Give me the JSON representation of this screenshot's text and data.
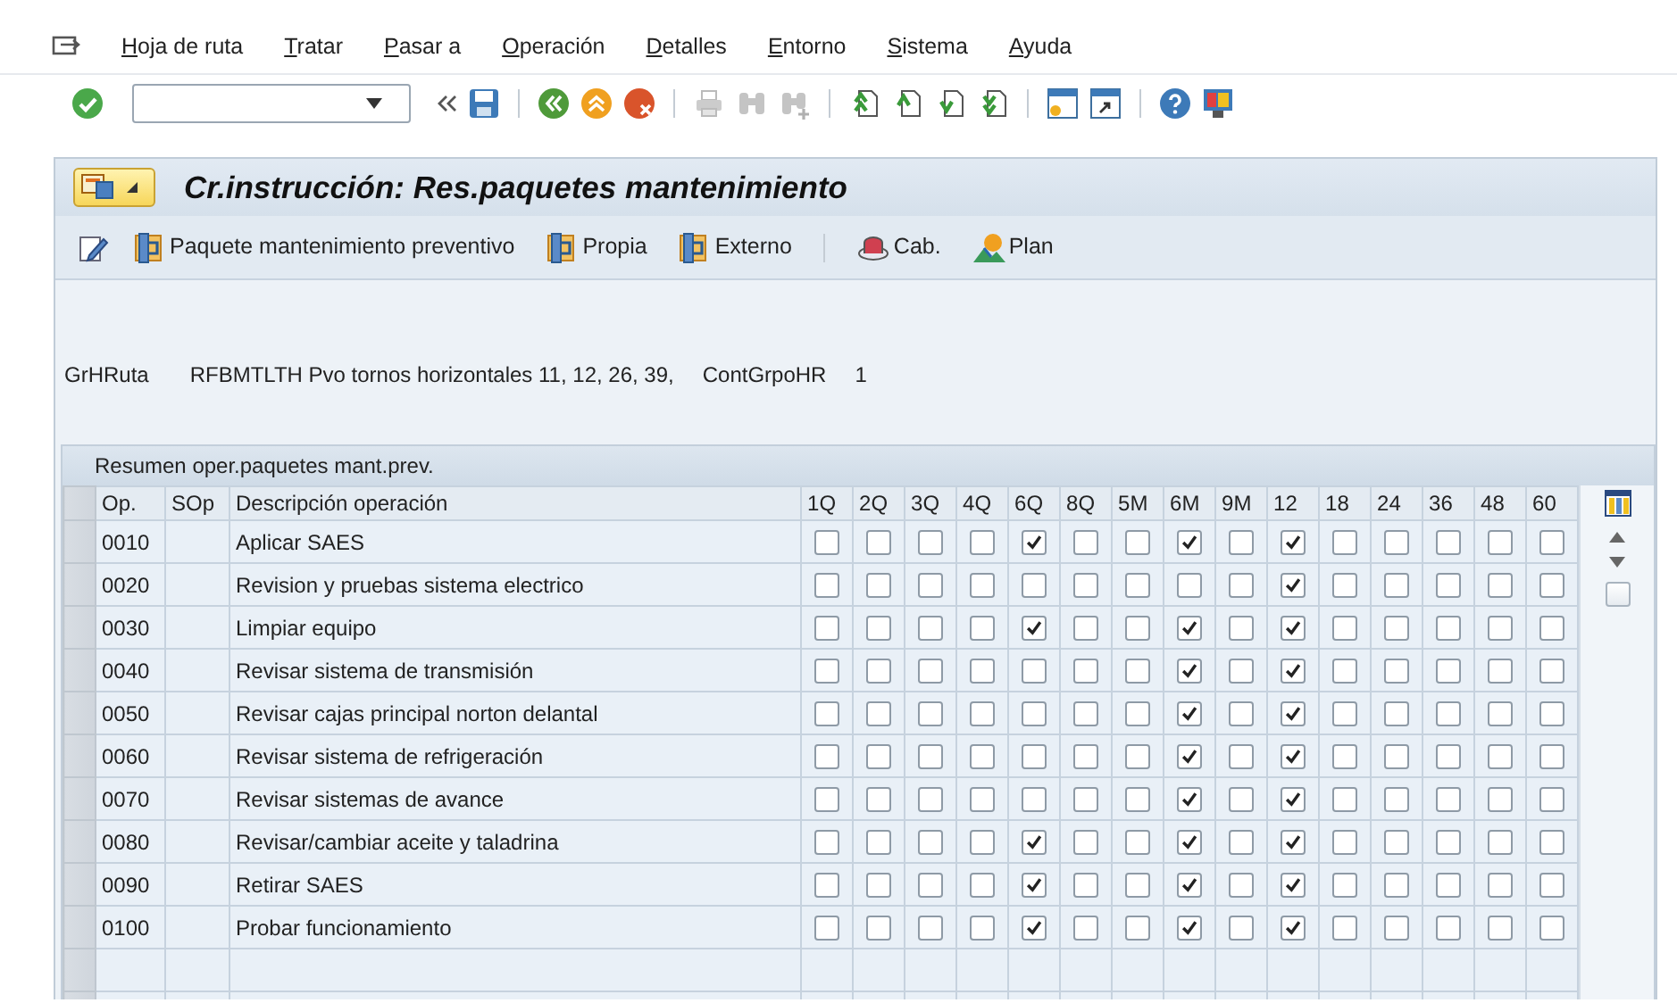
{
  "menu": [
    {
      "label": "Hoja de ruta"
    },
    {
      "label": "Tratar"
    },
    {
      "label": "Pasar a"
    },
    {
      "label": "Operación"
    },
    {
      "label": "Detalles"
    },
    {
      "label": "Entorno"
    },
    {
      "label": "Sistema"
    },
    {
      "label": "Ayuda"
    }
  ],
  "title": "Cr.instrucción: Res.paquetes mantenimiento",
  "app_toolbar": [
    {
      "label": "Paquete mantenimiento preventivo",
      "kind": "package"
    },
    {
      "label": "Propia",
      "kind": "package"
    },
    {
      "label": "Externo",
      "kind": "package"
    },
    {
      "label": "Cab.",
      "kind": "header"
    },
    {
      "label": "Plan",
      "kind": "plan"
    }
  ],
  "header_fields": [
    {
      "label": "GrHRuta",
      "value": "RFBMTLTH Pvo tornos horizontales 11, 12, 26, 39,"
    },
    {
      "label": "ContGrpoHR",
      "value": "1"
    }
  ],
  "table": {
    "title": "Resumen oper.paquetes mant.prev.",
    "columns": [
      "Op.",
      "SOp",
      "Descripción operación",
      "1Q",
      "2Q",
      "3Q",
      "4Q",
      "6Q",
      "8Q",
      "5M",
      "6M",
      "9M",
      "12",
      "18",
      "24",
      "36",
      "48",
      "60"
    ],
    "rows": [
      {
        "op": "0010",
        "description": "Aplicar SAES",
        "checks": [
          false,
          false,
          false,
          false,
          true,
          false,
          false,
          true,
          false,
          true,
          false,
          false,
          false,
          false,
          false
        ]
      },
      {
        "op": "0020",
        "description": "Revision y pruebas sistema electrico",
        "checks": [
          false,
          false,
          false,
          false,
          false,
          false,
          false,
          false,
          false,
          true,
          false,
          false,
          false,
          false,
          false
        ]
      },
      {
        "op": "0030",
        "description": "Limpiar equipo",
        "checks": [
          false,
          false,
          false,
          false,
          true,
          false,
          false,
          true,
          false,
          true,
          false,
          false,
          false,
          false,
          false
        ]
      },
      {
        "op": "0040",
        "description": "Revisar sistema de transmisión",
        "checks": [
          false,
          false,
          false,
          false,
          false,
          false,
          false,
          true,
          false,
          true,
          false,
          false,
          false,
          false,
          false
        ]
      },
      {
        "op": "0050",
        "description": "Revisar cajas principal norton delantal",
        "checks": [
          false,
          false,
          false,
          false,
          false,
          false,
          false,
          true,
          false,
          true,
          false,
          false,
          false,
          false,
          false
        ]
      },
      {
        "op": "0060",
        "description": "Revisar sistema de refrigeración",
        "checks": [
          false,
          false,
          false,
          false,
          false,
          false,
          false,
          true,
          false,
          true,
          false,
          false,
          false,
          false,
          false
        ]
      },
      {
        "op": "0070",
        "description": "Revisar sistemas de avance",
        "checks": [
          false,
          false,
          false,
          false,
          false,
          false,
          false,
          true,
          false,
          true,
          false,
          false,
          false,
          false,
          false
        ]
      },
      {
        "op": "0080",
        "description": "Revisar/cambiar aceite y taladrina",
        "checks": [
          false,
          false,
          false,
          false,
          true,
          false,
          false,
          true,
          false,
          true,
          false,
          false,
          false,
          false,
          false
        ]
      },
      {
        "op": "0090",
        "description": "Retirar SAES",
        "checks": [
          false,
          false,
          false,
          false,
          true,
          false,
          false,
          true,
          false,
          true,
          false,
          false,
          false,
          false,
          false
        ]
      },
      {
        "op": "0100",
        "description": "Probar funcionamiento",
        "checks": [
          false,
          false,
          false,
          false,
          true,
          false,
          false,
          true,
          false,
          true,
          false,
          false,
          false,
          false,
          false
        ]
      }
    ]
  }
}
